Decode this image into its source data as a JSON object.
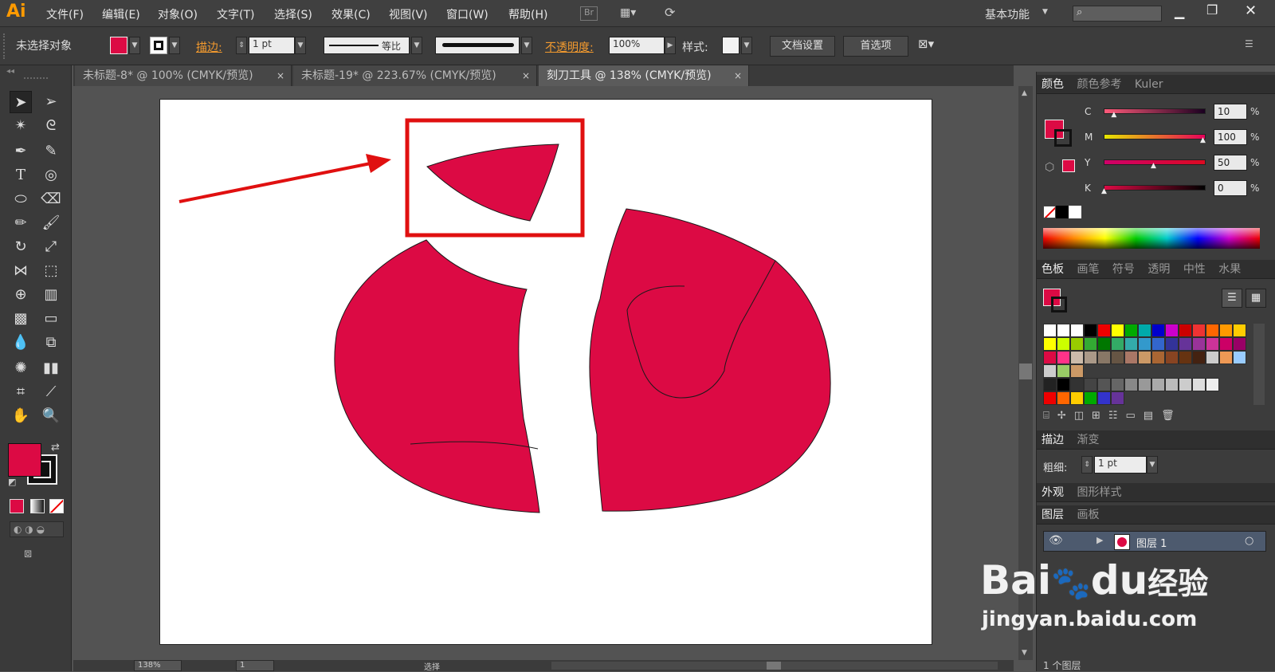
{
  "app": {
    "logo": "Ai"
  },
  "menu": [
    "文件(F)",
    "编辑(E)",
    "对象(O)",
    "文字(T)",
    "选择(S)",
    "效果(C)",
    "视图(V)",
    "窗口(W)",
    "帮助(H)"
  ],
  "menubar_right": {
    "bridge": "Br",
    "workspace": "基本功能"
  },
  "control": {
    "selection_label": "未选择对象",
    "stroke_label": "描边:",
    "stroke_weight": "1 pt",
    "stroke_profile": "等比",
    "opacity_label": "不透明度:",
    "opacity_value": "100%",
    "style_label": "样式:",
    "doc_setup": "文档设置",
    "preferences": "首选项"
  },
  "tabs": [
    {
      "title": "未标题-8* @ 100% (CMYK/预览)",
      "close": "×"
    },
    {
      "title": "未标题-19* @ 223.67% (CMYK/预览)",
      "close": "×"
    },
    {
      "title": "刻刀工具 @ 138% (CMYK/预览)",
      "close": "×"
    }
  ],
  "color_panel": {
    "tabs": [
      "颜色",
      "颜色参考",
      "Kuler"
    ],
    "channels": [
      {
        "label": "C",
        "value": "10",
        "unit": "%",
        "level": 0.1
      },
      {
        "label": "M",
        "value": "100",
        "unit": "%",
        "level": 1.0
      },
      {
        "label": "Y",
        "value": "50",
        "unit": "%",
        "level": 0.5
      },
      {
        "label": "K",
        "value": "0",
        "unit": "%",
        "level": 0.0
      }
    ]
  },
  "swatches_panel": {
    "tabs": [
      "色板",
      "画笔",
      "符号",
      "透明",
      "中性",
      "水果"
    ]
  },
  "stroke_panel": {
    "tabs": [
      "描边",
      "渐变"
    ],
    "weight_label": "粗细:",
    "weight_value": "1 pt"
  },
  "appearance_panel": {
    "tabs": [
      "外观",
      "图形样式"
    ]
  },
  "layers_panel": {
    "tabs": [
      "图层",
      "画板"
    ],
    "layer_name": "图层 1",
    "count": "1 个图层"
  },
  "status": {
    "zoom": "138%",
    "page": "1",
    "mode": "选择"
  },
  "watermark": {
    "line1": "Bai",
    "line2": "du",
    "cn": "经验",
    "url": "jingyan.baidu.com"
  },
  "colors": {
    "fill": "#dc0a44",
    "highlight": "#e01010",
    "stroke": "#1a1a1a"
  }
}
